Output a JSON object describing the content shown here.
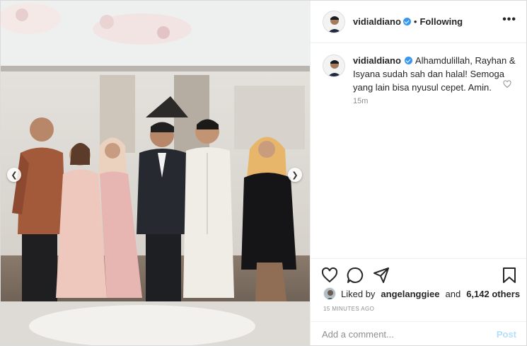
{
  "post": {
    "author": "vidialdiano",
    "follow_status": "Following",
    "separator": "•",
    "more_label": "•••"
  },
  "caption": {
    "author": "vidialdiano",
    "text": "Alhamdulillah, Rayhan & Isyana sudah sah dan halal! Semoga yang lain bisa nyusul cepet. Amin.",
    "time": "15m"
  },
  "likes": {
    "prefix": "Liked by",
    "user": "angelanggiee",
    "and": "and",
    "others": "6,142 others"
  },
  "timestamp": "15 MINUTES AGO",
  "comment_box": {
    "placeholder": "Add a comment...",
    "post_label": "Post"
  },
  "icons": {
    "verified": "verified-badge-icon",
    "like": "heart-icon",
    "comment": "comment-bubble-icon",
    "share": "paper-plane-icon",
    "save": "bookmark-icon",
    "prev": "chevron-left-icon",
    "next": "chevron-right-icon"
  },
  "colors": {
    "verified_blue": "#3897f0",
    "post_disabled": "#b2dffc",
    "secondary_text": "#8e8e8e"
  }
}
